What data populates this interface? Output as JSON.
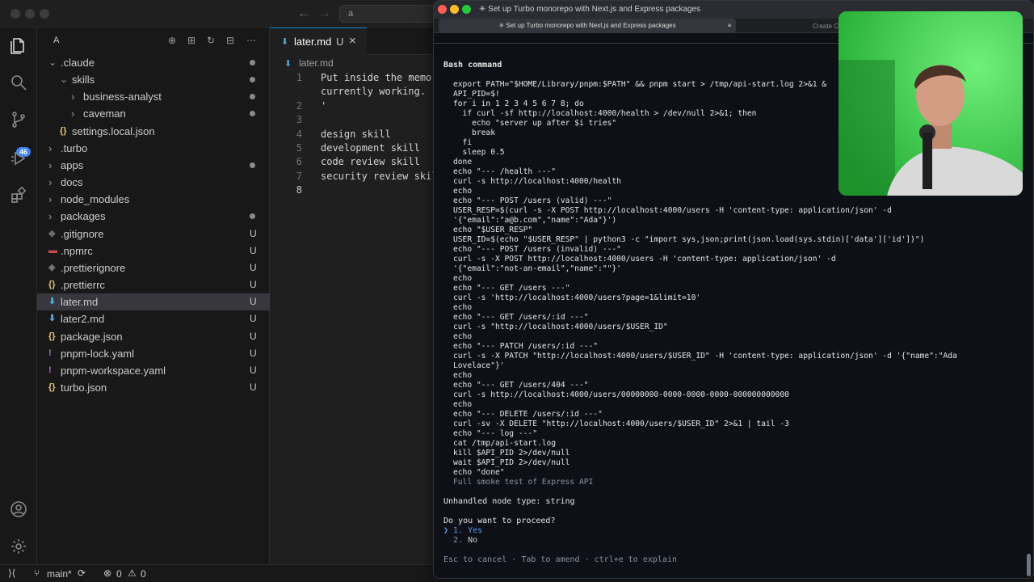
{
  "vscode": {
    "command_center": "a",
    "explorer_title": "A",
    "activity_badge": "46",
    "tree": [
      {
        "name": "claude-folder",
        "label": ".claude",
        "type": "folder",
        "open": true,
        "depth": 1,
        "marker": "dot"
      },
      {
        "name": "skills-folder",
        "label": "skills",
        "type": "folder",
        "open": true,
        "depth": 2,
        "marker": "dot"
      },
      {
        "name": "business-analyst-folder",
        "label": "business-analyst",
        "type": "folder",
        "open": false,
        "depth": 3,
        "marker": "dot"
      },
      {
        "name": "caveman-folder",
        "label": "caveman",
        "type": "folder",
        "open": false,
        "depth": 3,
        "marker": "dot"
      },
      {
        "name": "settings-local-json",
        "label": "settings.local.json",
        "type": "json",
        "depth": 2,
        "marker": ""
      },
      {
        "name": "turbo-folder",
        "label": ".turbo",
        "type": "folder",
        "open": false,
        "depth": 1,
        "marker": ""
      },
      {
        "name": "apps-folder",
        "label": "apps",
        "type": "folder",
        "open": false,
        "depth": 1,
        "marker": "dot"
      },
      {
        "name": "docs-folder",
        "label": "docs",
        "type": "folder",
        "open": false,
        "depth": 1,
        "marker": ""
      },
      {
        "name": "node-modules-folder",
        "label": "node_modules",
        "type": "folder",
        "open": false,
        "depth": 1,
        "marker": ""
      },
      {
        "name": "packages-folder",
        "label": "packages",
        "type": "folder",
        "open": false,
        "depth": 1,
        "marker": "dot"
      },
      {
        "name": "gitignore-file",
        "label": ".gitignore",
        "type": "git",
        "depth": 1,
        "marker": "U"
      },
      {
        "name": "npmrc-file",
        "label": ".npmrc",
        "type": "npm",
        "depth": 1,
        "marker": "U"
      },
      {
        "name": "prettierignore-file",
        "label": ".prettierignore",
        "type": "prettier",
        "depth": 1,
        "marker": "U"
      },
      {
        "name": "prettierrc-file",
        "label": ".prettierrc",
        "type": "json",
        "depth": 1,
        "marker": "U"
      },
      {
        "name": "later-md-file",
        "label": "later.md",
        "type": "md",
        "depth": 1,
        "marker": "U",
        "selected": true
      },
      {
        "name": "later2-md-file",
        "label": "later2.md",
        "type": "md",
        "depth": 1,
        "marker": "U"
      },
      {
        "name": "package-json-file",
        "label": "package.json",
        "type": "json",
        "depth": 1,
        "marker": "U"
      },
      {
        "name": "pnpm-lock-file",
        "label": "pnpm-lock.yaml",
        "type": "yaml",
        "depth": 1,
        "marker": "U"
      },
      {
        "name": "pnpm-workspace-file",
        "label": "pnpm-workspace.yaml",
        "type": "yaml",
        "depth": 1,
        "marker": "U"
      },
      {
        "name": "turbo-json-file",
        "label": "turbo.json",
        "type": "json",
        "depth": 1,
        "marker": "U"
      }
    ],
    "tab": {
      "label": "later.md",
      "status": "U"
    },
    "breadcrumb": "later.md",
    "code": [
      {
        "n": "1",
        "text": "Put inside the memor"
      },
      {
        "n": "",
        "text": "currently working."
      },
      {
        "n": "2",
        "text": "'"
      },
      {
        "n": "3",
        "text": ""
      },
      {
        "n": "4",
        "text": "design skill"
      },
      {
        "n": "5",
        "text": "development skill"
      },
      {
        "n": "6",
        "text": "code review skill"
      },
      {
        "n": "7",
        "text": "security review skil"
      },
      {
        "n": "8",
        "text": ""
      }
    ],
    "status": {
      "branch": "main*",
      "errors": "0",
      "warnings": "0"
    }
  },
  "terminal": {
    "window_title": "✳ Set up Turbo monorepo with Next.js and Express packages",
    "tab_title": "✳ Set up Turbo monorepo with Next.js and Express packages",
    "new_tab_label": "Create C",
    "heading": "Bash command",
    "command_lines": [
      "export PATH=\"$HOME/Library/pnpm:$PATH\" && pnpm start > /tmp/api-start.log 2>&1 &",
      "API_PID=$!",
      "for i in 1 2 3 4 5 6 7 8; do",
      "  if curl -sf http://localhost:4000/health > /dev/null 2>&1; then",
      "    echo \"server up after $i tries\"",
      "    break",
      "  fi",
      "  sleep 0.5",
      "done",
      "echo \"--- /health ---\"",
      "curl -s http://localhost:4000/health",
      "echo",
      "echo \"--- POST /users (valid) ---\"",
      "USER_RESP=$(curl -s -X POST http://localhost:4000/users -H 'content-type: application/json' -d",
      "'{\"email\":\"a@b.com\",\"name\":\"Ada\"}')",
      "echo \"$USER_RESP\"",
      "USER_ID=$(echo \"$USER_RESP\" | python3 -c \"import sys,json;print(json.load(sys.stdin)['data']['id'])\")",
      "echo \"--- POST /users (invalid) ---\"",
      "curl -s -X POST http://localhost:4000/users -H 'content-type: application/json' -d",
      "'{\"email\":\"not-an-email\",\"name\":\"\"}'",
      "echo",
      "echo \"--- GET /users ---\"",
      "curl -s 'http://localhost:4000/users?page=1&limit=10'",
      "echo",
      "echo \"--- GET /users/:id ---\"",
      "curl -s \"http://localhost:4000/users/$USER_ID\"",
      "echo",
      "echo \"--- PATCH /users/:id ---\"",
      "curl -s -X PATCH \"http://localhost:4000/users/$USER_ID\" -H 'content-type: application/json' -d '{\"name\":\"Ada",
      "Lovelace\"}'",
      "echo",
      "echo \"--- GET /users/404 ---\"",
      "curl -s http://localhost:4000/users/00000000-0000-0000-0000-000000000000",
      "echo",
      "echo \"--- DELETE /users/:id ---\"",
      "curl -sv -X DELETE \"http://localhost:4000/users/$USER_ID\" 2>&1 | tail -3",
      "echo \"--- log ---\"",
      "cat /tmp/api-start.log",
      "kill $API_PID 2>/dev/null",
      "wait $API_PID 2>/dev/null",
      "echo \"done\""
    ],
    "description": "Full smoke test of Express API",
    "warning": "Unhandled node type: string",
    "question": "Do you want to proceed?",
    "cursor": "❯",
    "options": [
      {
        "num": "1.",
        "label": "Yes",
        "selected": true
      },
      {
        "num": "2.",
        "label": "No",
        "selected": false
      }
    ],
    "footer": "Esc to cancel · Tab to amend · ctrl+e to explain"
  },
  "colors": {
    "accent": "#0078d4",
    "terminal_bg": "#0d1117",
    "selection": "#5b9bf0",
    "webcam_green": "#39d44a"
  }
}
